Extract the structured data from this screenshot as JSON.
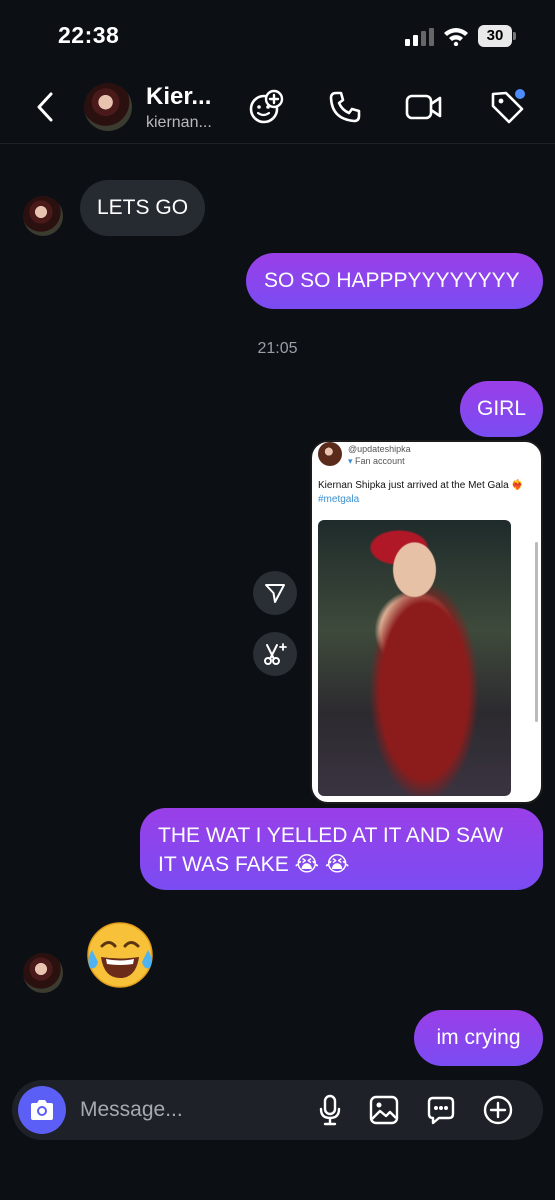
{
  "status_bar": {
    "time": "22:38",
    "battery": "30"
  },
  "header": {
    "name": "Kier...",
    "handle": "kiernan..."
  },
  "messages": {
    "lets_go": "LETS GO",
    "so_happy": "SO SO HAPPPYYYYYYYY",
    "timestamp": "21:05",
    "girl": "GIRL",
    "fake_line1": "THE WAT I YELLED AT IT AND SAW",
    "fake_line2": "IT WAS FAKE 😭 😭",
    "im_crying": "im crying"
  },
  "shared_post": {
    "handle": "@updateshipka",
    "subtitle": "Fan account",
    "caption": "Kiernan Shipka just arrived at the Met Gala ❤️‍🔥",
    "hashtag": "#metgala"
  },
  "composer": {
    "placeholder": "Message..."
  },
  "colors": {
    "outgoing": "#8a45ee",
    "incoming": "#262a31",
    "accent": "#5b5ff5",
    "background": "#0c0f14"
  }
}
